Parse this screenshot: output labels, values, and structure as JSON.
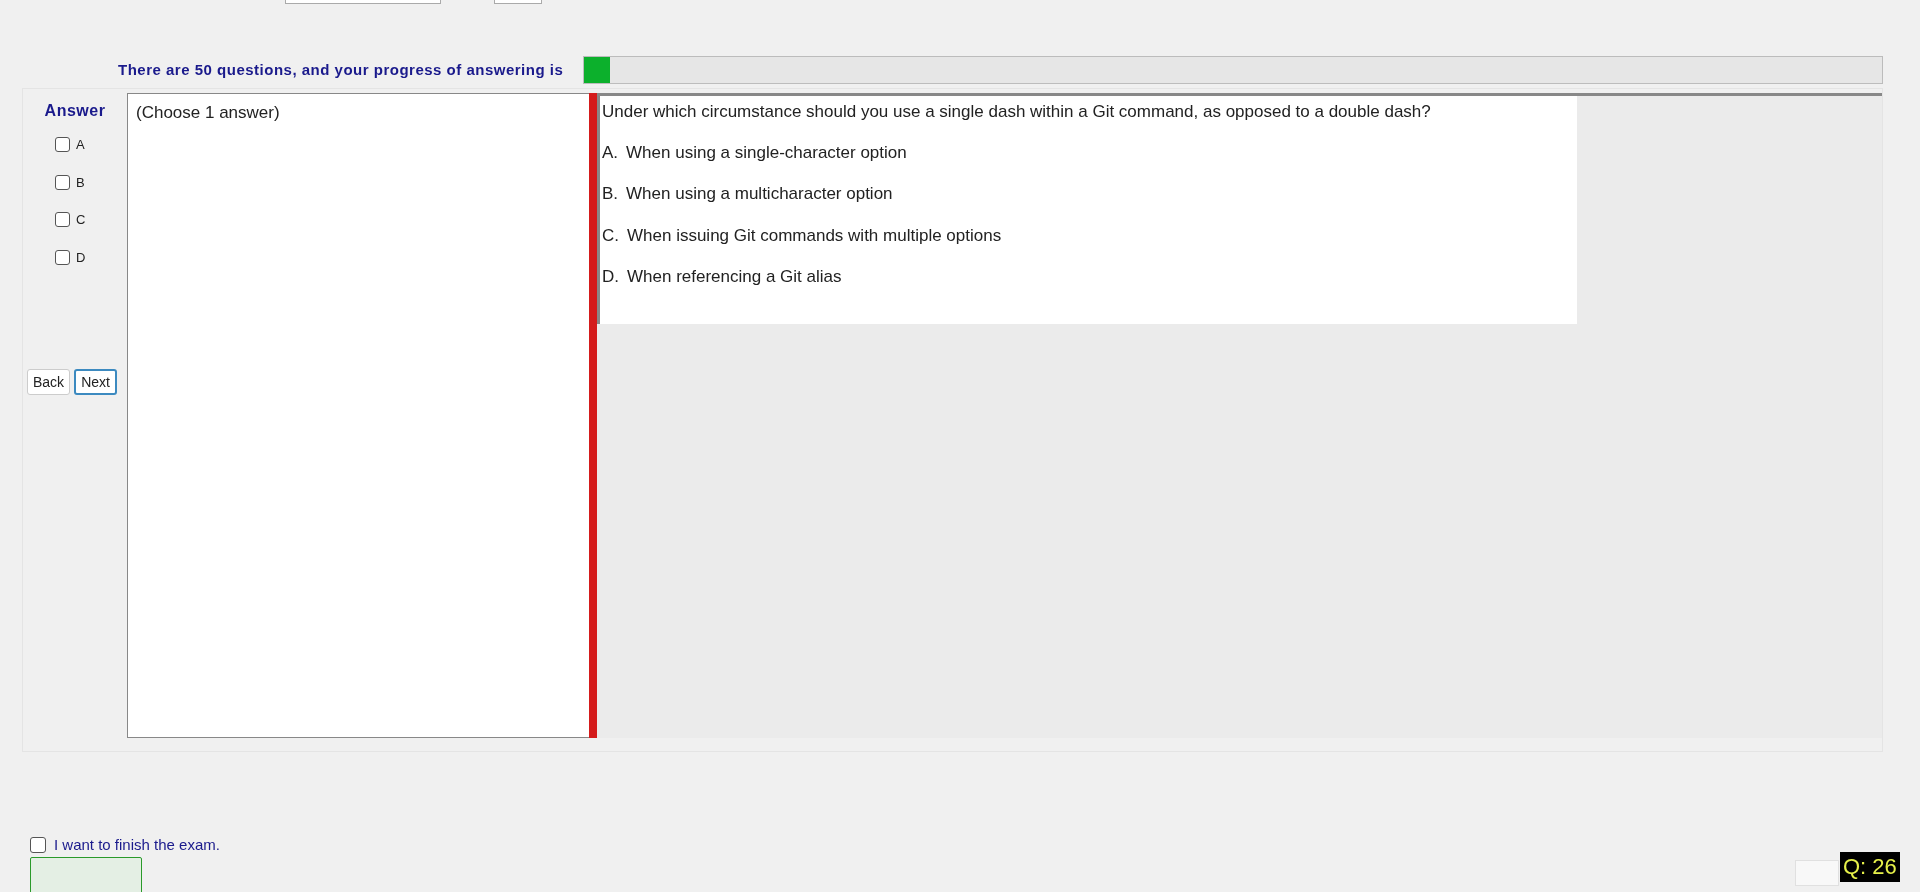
{
  "progress": {
    "label": "There are 50 questions, and your progress of answering is",
    "level": 0.02
  },
  "answer_panel": {
    "title": "Answer",
    "options": [
      {
        "label": "A",
        "checked": false
      },
      {
        "label": "B",
        "checked": false
      },
      {
        "label": "C",
        "checked": false
      },
      {
        "label": "D",
        "checked": false
      }
    ],
    "buttons": [
      {
        "label": "Back",
        "focused": false
      },
      {
        "label": "Next",
        "focused": true
      }
    ]
  },
  "instruction": "(Choose 1 answer)",
  "question": {
    "text": "Under which circumstance should you use a single dash within a Git command, as opposed to a double dash?",
    "choices": [
      {
        "letter": "A.",
        "text": "When using a single-character option"
      },
      {
        "letter": "B.",
        "text": "When using a multicharacter option"
      },
      {
        "letter": "C.",
        "text": "When issuing Git commands with multiple options"
      },
      {
        "letter": "D.",
        "text": "When referencing a Git alias"
      }
    ]
  },
  "finish": {
    "label": "I want to finish the exam.",
    "checked": false
  },
  "question_counter": "Q: 26"
}
